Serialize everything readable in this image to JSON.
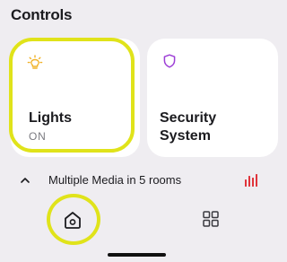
{
  "header": {
    "title": "Controls"
  },
  "tiles": [
    {
      "label": "Lights",
      "status": "ON",
      "icon": "lightbulb-icon",
      "icon_color": "#f1b32a"
    },
    {
      "label": "Security System",
      "icon": "shield-icon",
      "icon_color": "#9d3fd6"
    }
  ],
  "media": {
    "text": "Multiple Media in 5 rooms",
    "icon": "equalizer-icon",
    "icon_color": "#e0343b"
  },
  "nav": {
    "items": [
      {
        "icon": "home-icon"
      },
      {
        "icon": "grid-icon"
      }
    ]
  },
  "colors": {
    "highlight": "#e0e31a",
    "background": "#efedf1",
    "tile_background": "#ffffff"
  }
}
